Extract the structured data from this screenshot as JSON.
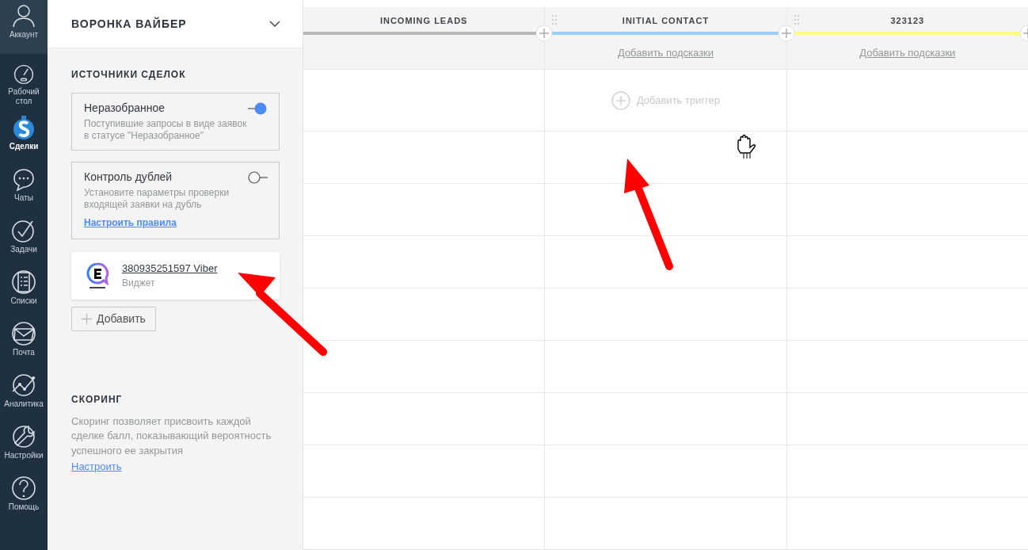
{
  "nav": [
    {
      "label": "Аккаунт",
      "selected": false
    },
    {
      "label": "Рабочий стол",
      "selected": false
    },
    {
      "label": "Сделки",
      "selected": true
    },
    {
      "label": "Чаты",
      "selected": false
    },
    {
      "label": "Задачи",
      "selected": false
    },
    {
      "label": "Списки",
      "selected": false
    },
    {
      "label": "Почта",
      "selected": false
    },
    {
      "label": "Аналитика",
      "selected": false
    },
    {
      "label": "Настройки",
      "selected": false
    },
    {
      "label": "Помощь",
      "selected": false
    }
  ],
  "pipeline": {
    "title": "ВОРОНКА ВАЙБЕР"
  },
  "sources": {
    "title": "ИСТОЧНИКИ СДЕЛОК",
    "items": [
      {
        "kind": "toggle",
        "title": "Неразобранное",
        "description": "Поступившие запросы в виде заявок в статусе \"Неразобранное\"",
        "on": true
      },
      {
        "kind": "toggle",
        "title": "Контроль дублей",
        "description": "Установите параметры проверки входящей заявки на дубль",
        "on": false,
        "link": "Настроить правила"
      },
      {
        "kind": "widget",
        "title": "380935251597 Viber",
        "subtitle": "Виджет"
      }
    ],
    "add_button": "Добавить"
  },
  "scoring": {
    "title": "СКОРИНГ",
    "text": "Скоринг позволяет присвоить каждой сделке балл, показывающий вероятность успешного ее закрытия",
    "link": "Настроить"
  },
  "columns": [
    {
      "name": "INCOMING LEADS",
      "color": "#b7b7b7"
    },
    {
      "name": "INITIAL CONTACT",
      "color": "#99ccff",
      "hint": "Добавить подсказки",
      "trigger": "Добавить триггер"
    },
    {
      "name": "323123",
      "color": "#fffd7f",
      "hint": "Добавить подсказки"
    }
  ]
}
